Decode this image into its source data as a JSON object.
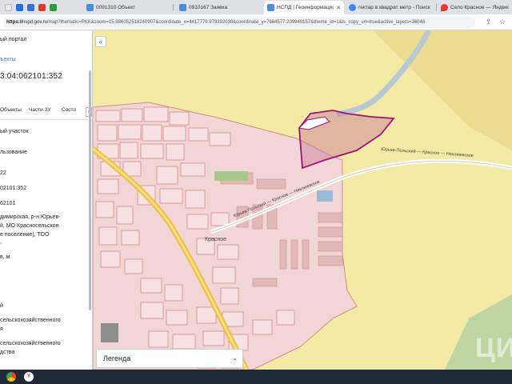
{
  "browser": {
    "tabs": [
      {
        "title": "",
        "icon": "blank",
        "color": "#e8e8e8"
      },
      {
        "title": "",
        "icon": "mail",
        "color": "#1f6fe5"
      },
      {
        "title": "",
        "icon": "vk",
        "color": "#3b6dd8"
      },
      {
        "title": "",
        "icon": "mail-red",
        "color": "#d63a2a"
      },
      {
        "title": "",
        "icon": "green",
        "color": "#2b9b3f"
      },
      {
        "title": "0091310 Объект",
        "icon": "ncpd",
        "color": "#4c8cd9"
      },
      {
        "title": "0910167 Заявка",
        "icon": "ncpd",
        "color": "#4c8cd9"
      },
      {
        "title": "НСПД | Геоинформационный",
        "icon": "ncpd",
        "color": "#4c8cd9"
      },
      {
        "title": "гектар в квадрат метр - Поиск",
        "icon": "google",
        "color": "#4285f4"
      },
      {
        "title": "Село Красное — Яндекс Карт",
        "icon": "yandex",
        "color": "#e53935"
      }
    ],
    "new_tab_label": "+",
    "url_scheme": "https://",
    "url_host": "nspd.gov.ru",
    "url_rest": "/map?thematic=PKK&zoom=15.986052518240907&coordinate_x=4417779.979392036&coordinate_y=7664577.209940157&theme_id=1&is_copy_url=true&active_layers=36048"
  },
  "panel": {
    "portal_title": "ый портал",
    "objects_link": "ъекты",
    "cad_number": "3:04:062101:352",
    "tabs": [
      "Объекты",
      "Части ЗУ",
      "Состо"
    ],
    "tab_next": "›",
    "object_type": "ый участок",
    "usage_label": "льзование",
    "line_22": "22",
    "line_cad2": "02101:352",
    "line_cad3": "62101",
    "address_1": "димирская, р-н Юрьев-",
    "address_2": "й, МО Красносельское",
    "address_3": "е поселение), ТОО",
    "address_more": "›",
    "area_label": "в, м",
    "category_1": "й",
    "category_2": "сельскохозяйственного",
    "category_3": "я",
    "usage_1": "сельскохозяйственного",
    "usage_2": "дства"
  },
  "map": {
    "collapse_label": "«",
    "village_label": "Красное",
    "road_label_1": "Юрьев-Польский — Красное — Неклюевское",
    "road_label_2": "Юрьев-Польский — Красное — Неклюевское",
    "legend_label": "Легенда",
    "legend_chevron": "⌄",
    "watermark": "ЦИАН",
    "colors": {
      "field": "#f3eaa6",
      "settlement": "#f2d6d6",
      "parcel_outline": "#d48a8a",
      "selected_parcel": "#a0127a",
      "road": "#e8c24a",
      "river": "#9bbad8",
      "forest": "#bfd6a2"
    }
  }
}
